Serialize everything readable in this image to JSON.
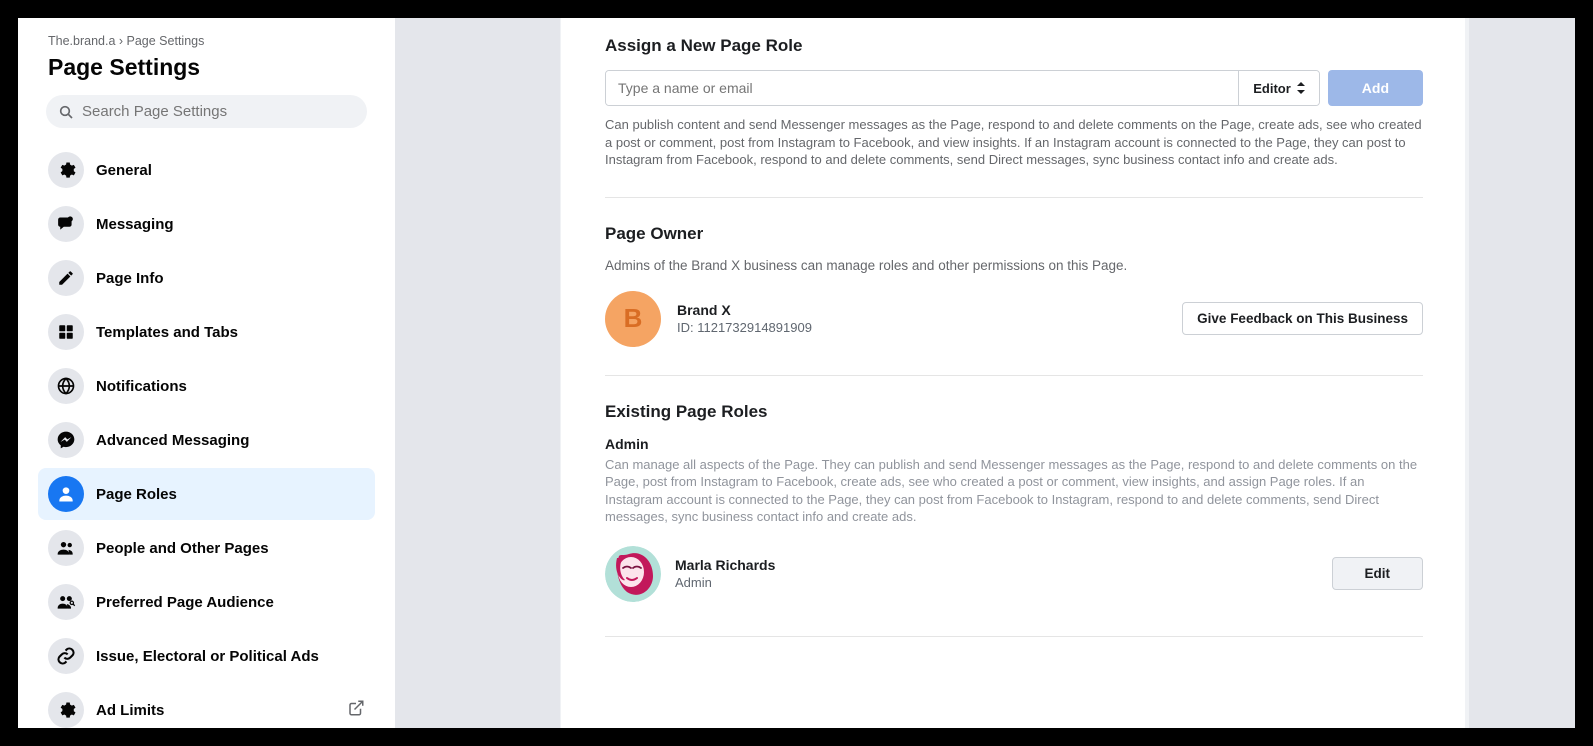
{
  "breadcrumb": "The.brand.a › Page Settings",
  "page_title": "Page Settings",
  "search": {
    "placeholder": "Search Page Settings"
  },
  "nav": [
    {
      "label": "General"
    },
    {
      "label": "Messaging"
    },
    {
      "label": "Page Info"
    },
    {
      "label": "Templates and Tabs"
    },
    {
      "label": "Notifications"
    },
    {
      "label": "Advanced Messaging"
    },
    {
      "label": "Page Roles"
    },
    {
      "label": "People and Other Pages"
    },
    {
      "label": "Preferred Page Audience"
    },
    {
      "label": "Issue, Electoral or Political Ads"
    },
    {
      "label": "Ad Limits"
    }
  ],
  "assign": {
    "title": "Assign a New Page Role",
    "input_placeholder": "Type a name or email",
    "role_selected": "Editor",
    "add_label": "Add",
    "help": "Can publish content and send Messenger messages as the Page, respond to and delete comments on the Page, create ads, see who created a post or comment, post from Instagram to Facebook, and view insights. If an Instagram account is connected to the Page, they can post to Instagram from Facebook, respond to and delete comments, send Direct messages, sync business contact info and create ads."
  },
  "owner": {
    "title": "Page Owner",
    "desc": "Admins of the Brand X business can manage roles and other permissions on this Page.",
    "initial": "B",
    "name": "Brand X",
    "id_label": "ID: 1121732914891909",
    "feedback_label": "Give Feedback on This Business"
  },
  "existing": {
    "title": "Existing Page Roles",
    "role_heading": "Admin",
    "role_desc": "Can manage all aspects of the Page. They can publish and send Messenger messages as the Page, respond to and delete comments on the Page, post from Instagram to Facebook, create ads, see who created a post or comment, view insights, and assign Page roles. If an Instagram account is connected to the Page, they can post from Facebook to Instagram, respond to and delete comments, send Direct messages, sync business contact info and create ads.",
    "user_name": "Marla Richards",
    "user_role": "Admin",
    "edit_label": "Edit"
  }
}
